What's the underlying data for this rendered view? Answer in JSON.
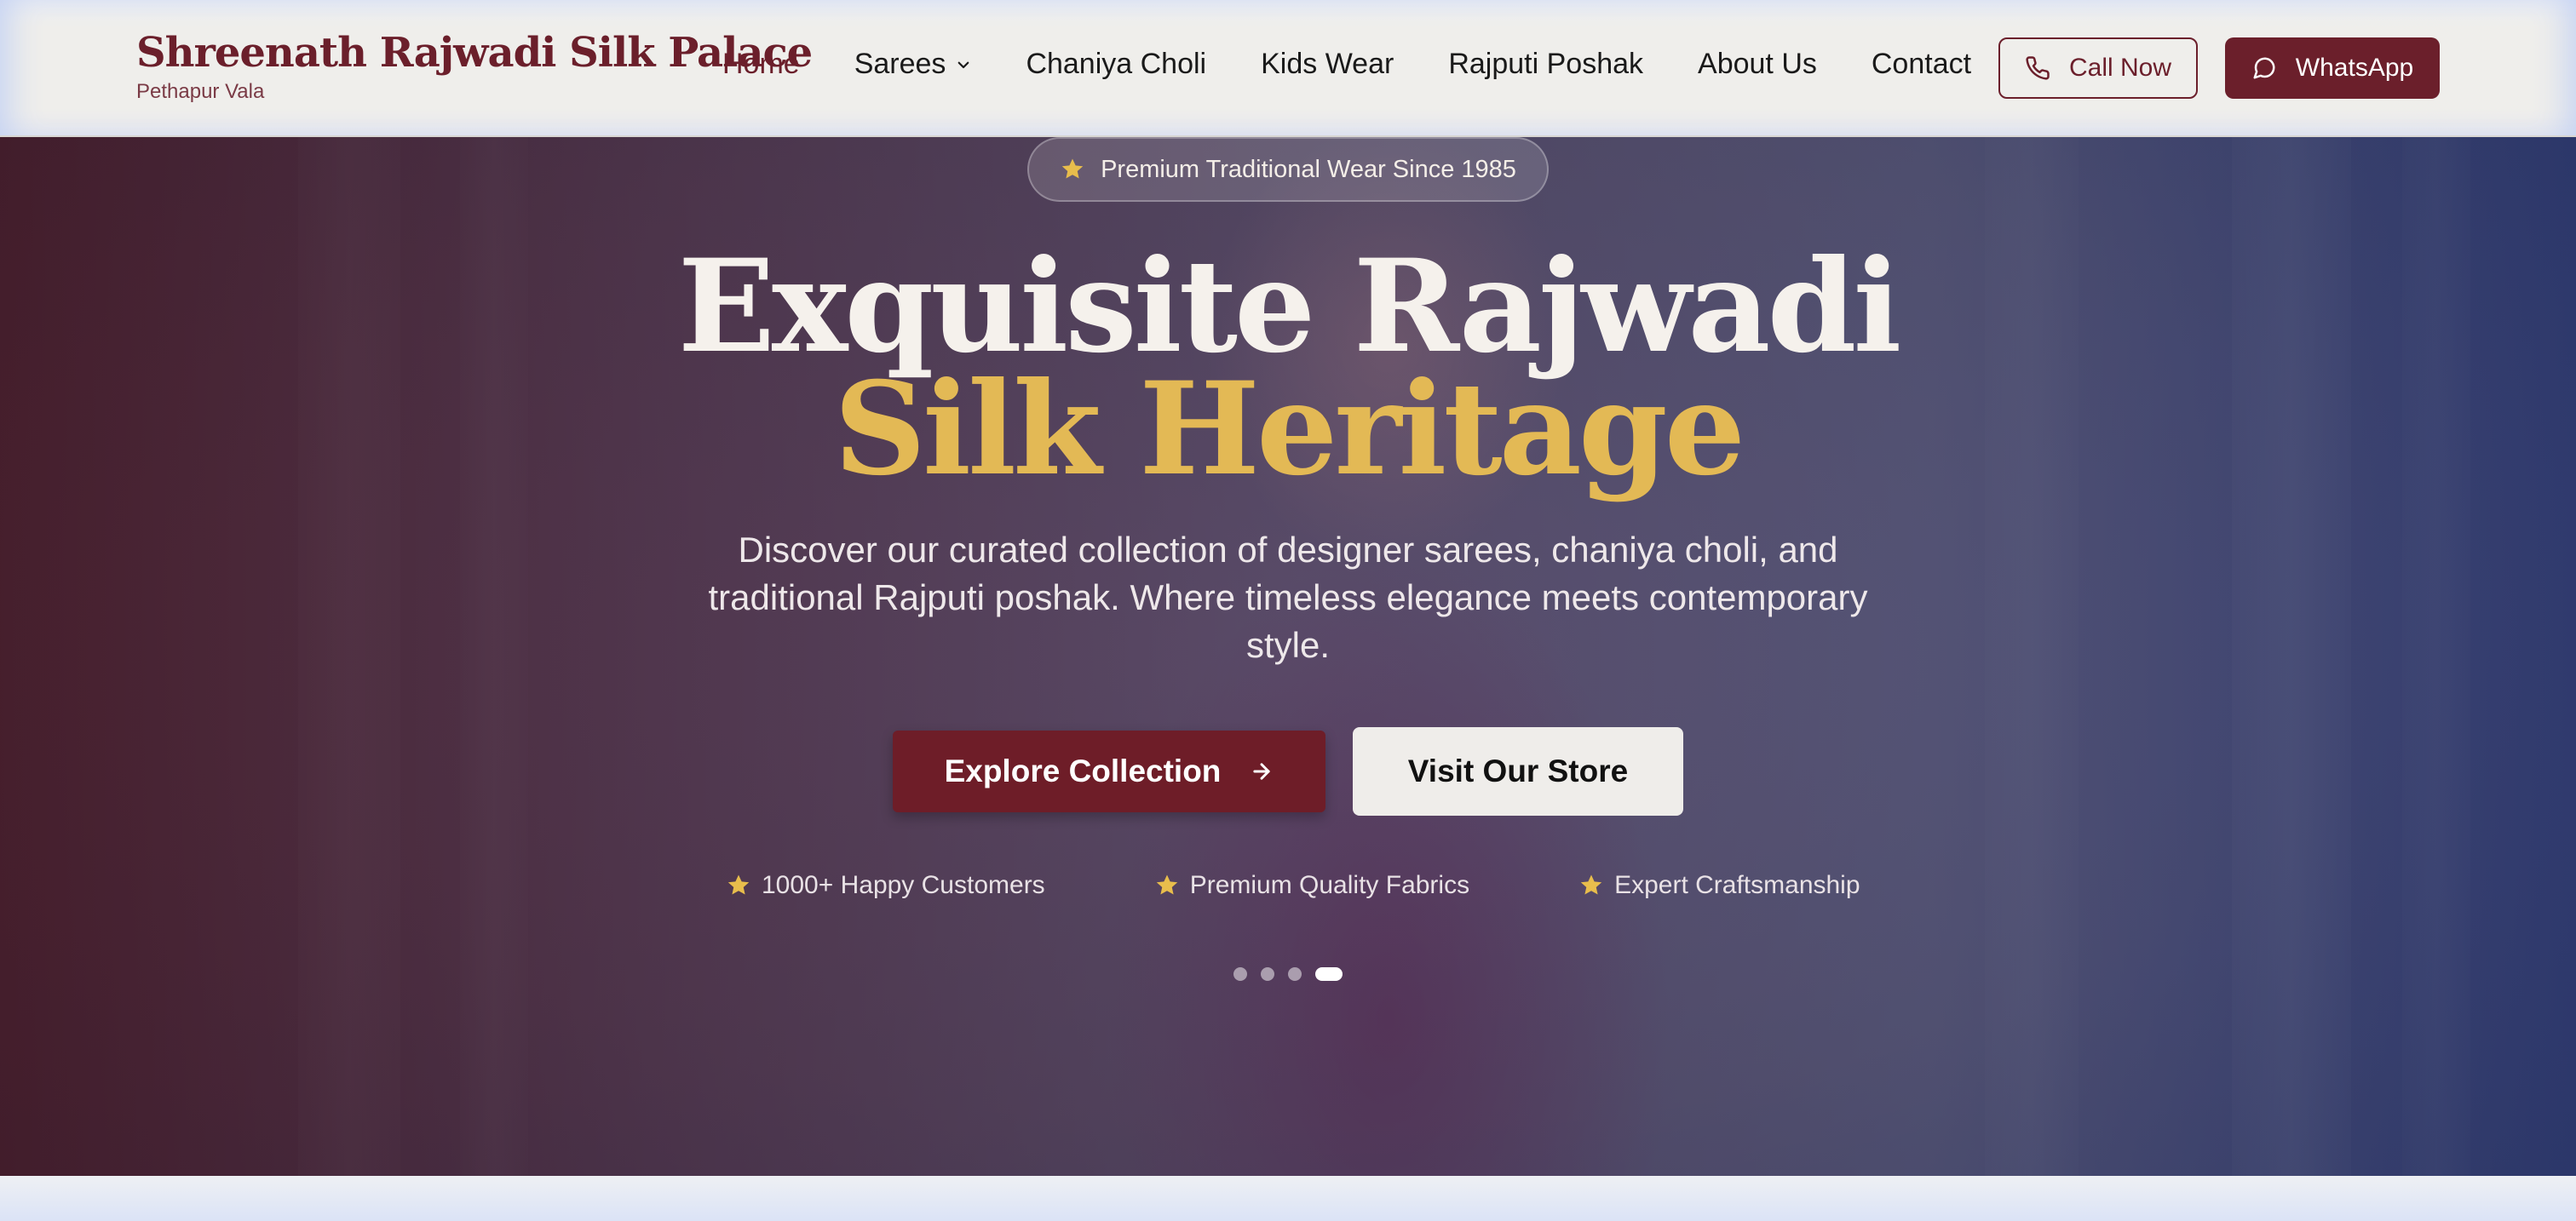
{
  "brand": {
    "name": "Shreenath Rajwadi Silk Palace",
    "subtitle": "Pethapur Vala"
  },
  "nav": {
    "items": [
      {
        "label": "Home",
        "active": true
      },
      {
        "label": "Sarees",
        "dropdown": true
      },
      {
        "label": "Chaniya Choli"
      },
      {
        "label": "Kids Wear"
      },
      {
        "label": "Rajputi Poshak"
      },
      {
        "label": "About Us"
      },
      {
        "label": "Contact"
      }
    ],
    "call_label": "Call Now",
    "call_icon": "phone-icon",
    "whatsapp_label": "WhatsApp",
    "whatsapp_icon": "chat-bubble-icon"
  },
  "hero": {
    "badge": "Premium Traditional Wear Since 1985",
    "title_line1": "Exquisite Rajwadi",
    "title_line2": "Silk Heritage",
    "description": "Discover our curated collection of designer sarees, chaniya choli, and traditional Rajputi poshak. Where timeless elegance meets contemporary style.",
    "primary_button": "Explore Collection",
    "secondary_button": "Visit Our Store",
    "features": [
      "1000+ Happy Customers",
      "Premium Quality Fabrics",
      "Expert Craftsmanship"
    ],
    "slides": {
      "count": 4,
      "active_index": 3
    }
  },
  "colors": {
    "brand": "#6b1f2b",
    "gold": "#e3b955",
    "header_bg": "#efeeeb"
  }
}
